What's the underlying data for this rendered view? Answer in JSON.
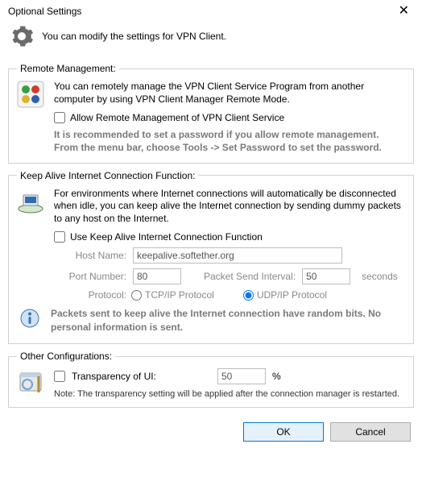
{
  "title": "Optional Settings",
  "header_text": "You can modify the settings for VPN Client.",
  "remote": {
    "legend": "Remote Management:",
    "desc": "You can remotely manage the VPN Client Service Program from another computer by using VPN Client Manager Remote Mode.",
    "checkbox_label": "Allow Remote Management of VPN Client Service",
    "hint": "It is recommended to set a password if you allow remote management. From the menu bar, choose Tools -> Set Password to set the password."
  },
  "keepalive": {
    "legend": "Keep Alive Internet Connection Function:",
    "desc": "For environments where Internet connections will automatically be disconnected when idle, you can keep alive the Internet connection by sending dummy packets to any host on the Internet.",
    "checkbox_label": "Use Keep Alive Internet Connection Function",
    "host_label": "Host Name:",
    "host_value": "keepalive.softether.org",
    "port_label": "Port Number:",
    "port_value": "80",
    "interval_label": "Packet Send Interval:",
    "interval_value": "50",
    "interval_unit": "seconds",
    "protocol_label": "Protocol:",
    "protocol_tcp": "TCP/IP Protocol",
    "protocol_udp": "UDP/IP Protocol",
    "info": "Packets sent to keep alive the Internet connection have random bits. No personal information is sent."
  },
  "other": {
    "legend": "Other Configurations:",
    "transparency_label": "Transparency of UI:",
    "transparency_value": "50",
    "transparency_unit": "%",
    "note": "Note: The transparency setting will be applied after the connection manager is restarted."
  },
  "buttons": {
    "ok": "OK",
    "cancel": "Cancel"
  }
}
